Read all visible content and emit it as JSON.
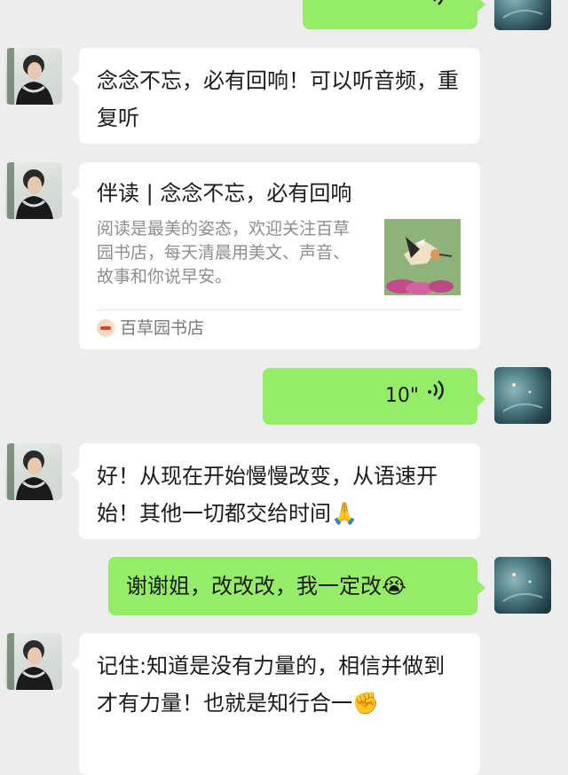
{
  "colors": {
    "background": "#ededed",
    "incoming_bubble": "#ffffff",
    "outgoing_bubble": "#95ec69",
    "card_desc": "#8e8e8e"
  },
  "messages": [
    {
      "id": "m0",
      "side": "right",
      "type": "voice",
      "duration": "",
      "icon": "voice-wave-icon"
    },
    {
      "id": "m1",
      "side": "left",
      "type": "text",
      "text": "念念不忘，必有回响！可以听音频，重复听"
    },
    {
      "id": "m2",
      "side": "left",
      "type": "link-card",
      "title": "伴读 | 念念不忘，必有回响",
      "description": "阅读是最美的姿态，欢迎关注百草园书店，每天清晨用美文、声音、故事和你说早安。",
      "source": "百草园书店",
      "thumbnail_icon": "bird-photo-thumbnail"
    },
    {
      "id": "m3",
      "side": "right",
      "type": "voice",
      "duration": "10\"",
      "icon": "voice-wave-icon"
    },
    {
      "id": "m4",
      "side": "left",
      "type": "text",
      "text": "好！从现在开始慢慢改变，从语速开始！其他一切都交给时间",
      "emoji": "🙏"
    },
    {
      "id": "m5",
      "side": "right",
      "type": "text",
      "text": "谢谢姐，改改改，我一定改",
      "emoji": "😭"
    },
    {
      "id": "m6",
      "side": "left",
      "type": "text",
      "text": "记住:知道是没有力量的，相信并做到才有力量！也就是知行合一",
      "emoji": "✊"
    }
  ]
}
